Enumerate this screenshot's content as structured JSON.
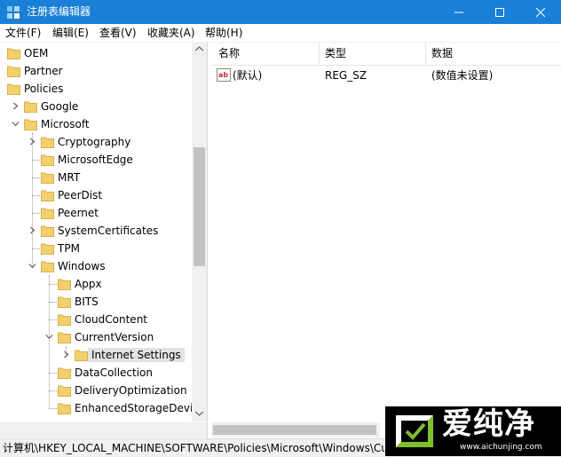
{
  "window": {
    "title": "注册表编辑器",
    "minimize_glyph": "—",
    "maximize_glyph": "☐",
    "close_glyph": "✕"
  },
  "menu": [
    {
      "label": "文件(F)"
    },
    {
      "label": "编辑(E)"
    },
    {
      "label": "查看(V)"
    },
    {
      "label": "收藏夹(A)"
    },
    {
      "label": "帮助(H)"
    }
  ],
  "tree": [
    {
      "label": "OEM",
      "level": 0,
      "expander": "none"
    },
    {
      "label": "Partner",
      "level": 0,
      "expander": "none"
    },
    {
      "label": "Policies",
      "level": 0,
      "expander": "none"
    },
    {
      "label": "Google",
      "level": 1,
      "expander": "collapsed"
    },
    {
      "label": "Microsoft",
      "level": 1,
      "expander": "expanded"
    },
    {
      "label": "Cryptography",
      "level": 2,
      "expander": "collapsed"
    },
    {
      "label": "MicrosoftEdge",
      "level": 2,
      "expander": "none"
    },
    {
      "label": "MRT",
      "level": 2,
      "expander": "none"
    },
    {
      "label": "PeerDist",
      "level": 2,
      "expander": "none"
    },
    {
      "label": "Peernet",
      "level": 2,
      "expander": "none"
    },
    {
      "label": "SystemCertificates",
      "level": 2,
      "expander": "collapsed"
    },
    {
      "label": "TPM",
      "level": 2,
      "expander": "none"
    },
    {
      "label": "Windows",
      "level": 2,
      "expander": "expanded"
    },
    {
      "label": "Appx",
      "level": 3,
      "expander": "none"
    },
    {
      "label": "BITS",
      "level": 3,
      "expander": "none"
    },
    {
      "label": "CloudContent",
      "level": 3,
      "expander": "none"
    },
    {
      "label": "CurrentVersion",
      "level": 3,
      "expander": "expanded"
    },
    {
      "label": "Internet Settings",
      "level": 4,
      "expander": "collapsed",
      "selected": true
    },
    {
      "label": "DataCollection",
      "level": 3,
      "expander": "none"
    },
    {
      "label": "DeliveryOptimization",
      "level": 3,
      "expander": "none"
    },
    {
      "label": "EnhancedStorageDevic",
      "level": 3,
      "expander": "none"
    }
  ],
  "columns": {
    "name": "名称",
    "type": "类型",
    "data": "数据"
  },
  "values": [
    {
      "icon_text": "ab",
      "name": "(默认)",
      "type": "REG_SZ",
      "data": "(数值未设置)"
    }
  ],
  "status": {
    "path": "计算机\\HKEY_LOCAL_MACHINE\\SOFTWARE\\Policies\\Microsoft\\Windows\\Cu"
  },
  "watermark": {
    "brand": "爱纯净",
    "url": "www.aichunjing.com"
  },
  "colors": {
    "titlebar": "#1a7fd6",
    "folder": "#f4cf6b",
    "selection": "#e3e3e3"
  }
}
